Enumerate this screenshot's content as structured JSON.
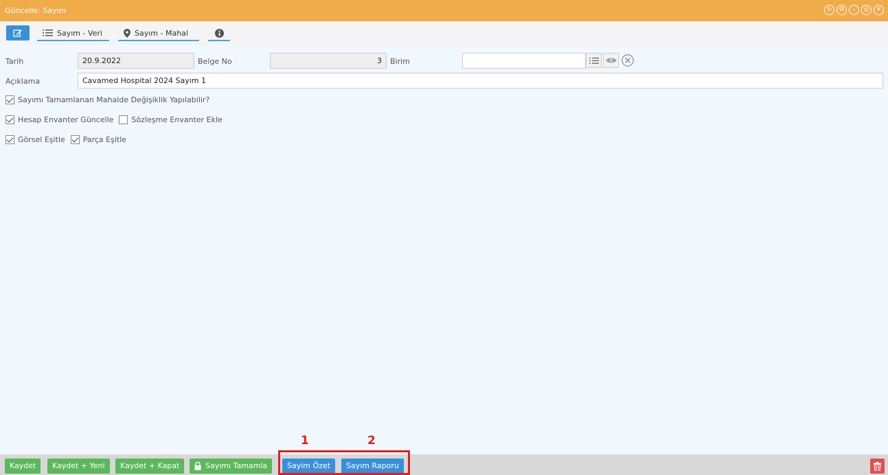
{
  "window": {
    "title": "Güncelle: Sayım"
  },
  "toolbar": {
    "tabs": [
      {
        "label": "Sayım - Veri"
      },
      {
        "label": "Sayım - Mahal"
      }
    ]
  },
  "form": {
    "tarih_label": "Tarih",
    "tarih_value": "20.9.2022",
    "belge_no_label": "Belge No",
    "belge_no_value": "3",
    "birim_label": "Birim",
    "birim_value": "",
    "aciklama_label": "Açıklama",
    "aciklama_value": "Cavamed Hospital 2024 Sayım 1"
  },
  "checkboxes": {
    "mahal_degisiklik": {
      "label": "Sayımı Tamamlanan Mahalde Değişiklik Yapılabilir?",
      "checked": true
    },
    "hesap_envanter": {
      "label": "Hesap Envanter Güncelle",
      "checked": true
    },
    "sozlesme_envanter": {
      "label": "Sözleşme Envanter Ekle",
      "checked": false
    },
    "gorsel_esitle": {
      "label": "Görsel Eşitle",
      "checked": true
    },
    "parca_esitle": {
      "label": "Parça Eşitle",
      "checked": true
    }
  },
  "footer": {
    "kaydet": "Kaydet",
    "kaydet_yeni": "Kaydet + Yeni",
    "kaydet_kapat": "Kaydet + Kapat",
    "sayimi_tamamla": "Sayımı Tamamla",
    "sayim_ozet": "Sayim Özet",
    "sayim_raporu": "Sayım Raporu"
  },
  "annotations": {
    "marker_1": "1",
    "marker_2": "2"
  },
  "colors": {
    "titlebar": "#f0ab4b",
    "primary": "#3a90d8",
    "success": "#5cb85c",
    "danger": "#e05050",
    "highlight": "#e02020"
  }
}
